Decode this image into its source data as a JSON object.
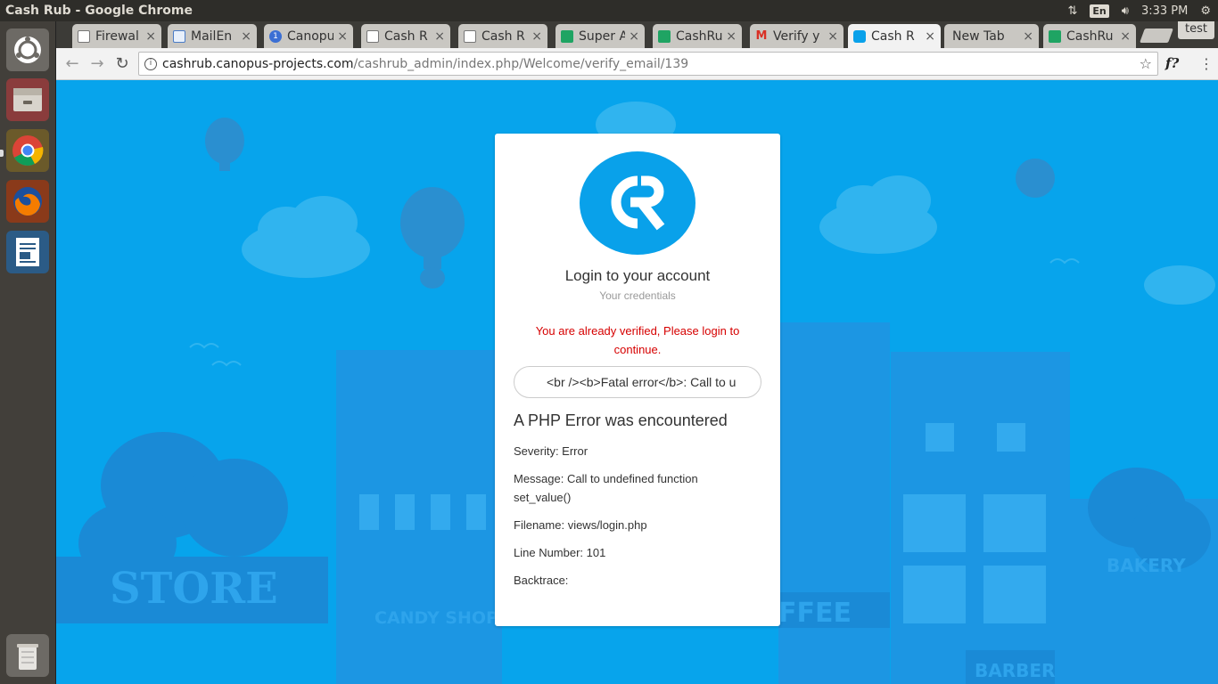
{
  "window": {
    "title": "Cash Rub - Google Chrome"
  },
  "tray": {
    "lang": "En",
    "time": "3:33 PM"
  },
  "profile": "test",
  "tabs": [
    {
      "label": "Firewal",
      "icon": "doc-icon",
      "color": "#777777"
    },
    {
      "label": "MailEn",
      "icon": "mail-icon",
      "color": "#4a7cc7"
    },
    {
      "label": "Canopu",
      "icon": "canopus-icon",
      "color": "#3b6fd4"
    },
    {
      "label": "Cash R",
      "icon": "doc-icon",
      "color": "#777777"
    },
    {
      "label": "Cash R",
      "icon": "doc-icon",
      "color": "#777777"
    },
    {
      "label": "Super A",
      "icon": "sheets-icon",
      "color": "#1fa463"
    },
    {
      "label": "CashRu",
      "icon": "sheets-icon",
      "color": "#1fa463"
    },
    {
      "label": "Verify y",
      "icon": "gmail-icon",
      "color": "#d93025"
    },
    {
      "label": "Cash R",
      "icon": "cashrub-icon",
      "color": "#09a1ea"
    },
    {
      "label": "New Tab",
      "icon": "",
      "color": ""
    },
    {
      "label": "CashRu",
      "icon": "sheets-icon",
      "color": "#1fa463"
    }
  ],
  "address": {
    "host": "cashrub.canopus-projects.com",
    "path": "/cashrub_admin/index.php/Welcome/verify_email/139"
  },
  "card": {
    "title": "Login to your account",
    "subtitle": "Your credentials",
    "alert": "You are already verified, Please login to continue.",
    "email_value": "<br /><b>Fatal error</b>:  Call to u",
    "error_heading": "A PHP Error was encountered",
    "severity": "Severity: Error",
    "message": "Message: Call to undefined function set_value()",
    "filename": "Filename: views/login.php",
    "line_number": "Line Number: 101",
    "backtrace": "Backtrace:"
  },
  "background_signs": {
    "store": "STORE",
    "candy": "CANDY SHOP",
    "coffee": "FFEE",
    "bakery": "BAKERY",
    "barber": "BARBER"
  },
  "colors": {
    "page_bg": "#07a4ec",
    "alert": "#d60000",
    "brand": "#09a1ea"
  }
}
